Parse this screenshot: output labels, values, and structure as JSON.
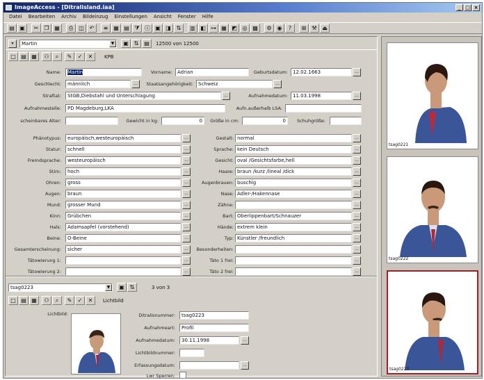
{
  "window": {
    "title": "ImageAccess - [Ditralisland.iaa]"
  },
  "menu": [
    "Datei",
    "Bearbeiten",
    "Archiv",
    "Bildeinzug",
    "Einstellungen",
    "Ansicht",
    "Fenster",
    "Hilfe"
  ],
  "top": {
    "record": "Martin",
    "counter": "12500 von 12500",
    "kpb": "KPB"
  },
  "person": {
    "name_label": "Name:",
    "name": "Martin",
    "vorname_label": "Vorname:",
    "vorname": "Adrian",
    "geburt_label": "Geburtsdatum:",
    "geburt": "12.02.1663",
    "geschlecht_label": "Geschlecht:",
    "geschlecht": "männlich",
    "staat_label": "Staatsangehörigkeit:",
    "staat": "Schweiz",
    "straftat_label": "Straftat:",
    "straftat": "StGB,Diebstahl und Unterschlagung",
    "aufnahme_datum_label": "Aufnahmedatum:",
    "aufnahme_datum": "11.03.1998",
    "aufnahmestelle_label": "Aufnahmestelle:",
    "aufnahmestelle": "PD Magdeburg,LKA",
    "auftrag_label": "Aufn.außerhalb LSA:",
    "alter_label": "scheinbares Alter:",
    "gewicht_label": "Gewicht in kg:",
    "gewicht": "0",
    "groesse_label": "Größe in cm:",
    "groesse": "0",
    "schuh_label": "Schuhgröße:"
  },
  "merkmale_left": [
    {
      "label": "Phänotypus:",
      "value": "europäisch,westeuropäisch"
    },
    {
      "label": "Statur:",
      "value": "schnell"
    },
    {
      "label": "Fremdsprache:",
      "value": "westeuropäisch"
    },
    {
      "label": "Stirn:",
      "value": "hoch"
    },
    {
      "label": "Ohren:",
      "value": "gross"
    },
    {
      "label": "Augen:",
      "value": "braun"
    },
    {
      "label": "Mund:",
      "value": "grosser Mund"
    },
    {
      "label": "Kinn:",
      "value": "Grübchen"
    },
    {
      "label": "Hals:",
      "value": "Adamsapfel (vorstehend)"
    },
    {
      "label": "Beine:",
      "value": "O-Beine"
    },
    {
      "label": "Gesamterscheinung:",
      "value": "sicher"
    },
    {
      "label": "Tätowierung 1:",
      "value": ""
    },
    {
      "label": "Tätowierung 2:",
      "value": ""
    }
  ],
  "merkmale_right": [
    {
      "label": "Gestalt:",
      "value": "normal"
    },
    {
      "label": "Sprache:",
      "value": "kein Deutsch"
    },
    {
      "label": "Gesicht:",
      "value": "oval /Gesichtsfarbe,hell"
    },
    {
      "label": "Haare:",
      "value": "braun /kurz /lineal /dick"
    },
    {
      "label": "Augenbrauen:",
      "value": "buschig"
    },
    {
      "label": "Nase:",
      "value": "Adler-/Hakennase"
    },
    {
      "label": "Zähne:",
      "value": ""
    },
    {
      "label": "Bart:",
      "value": "Oberlippenbart/Schnauzer"
    },
    {
      "label": "Hände:",
      "value": "extrem klein"
    },
    {
      "label": "Typ:",
      "value": "Künstler /freundlich"
    },
    {
      "label": "Besonderheiten:",
      "value": ""
    },
    {
      "label": "Täto 1 frei:",
      "value": ""
    },
    {
      "label": "Täto 2 frei:",
      "value": ""
    }
  ],
  "image_record": {
    "id": "tsag0223",
    "counter": "3 von 3",
    "lichtbild_tab": "Lichtbild",
    "lichtbild_label": "Lichtbild:",
    "ditra_label": "Ditralisnummer:",
    "ditra": "tsag0223",
    "art_label": "Aufnahmeart:",
    "art": "Profil",
    "datum_label": "Aufnahmedatum:",
    "datum": "30.11.1998",
    "lbnr_label": "Lichtbildnummer:",
    "erf_label": "Erfassungsdatum:",
    "sperre_label": "Lwr Sperren:"
  },
  "thumbnails": [
    {
      "caption": "tsag0221"
    },
    {
      "caption": "tsag0222"
    },
    {
      "caption": "tsag0223"
    }
  ],
  "colors": {
    "title_start": "#10246a",
    "selection": "#0a246a",
    "active_thumb_border": "#a02028"
  }
}
